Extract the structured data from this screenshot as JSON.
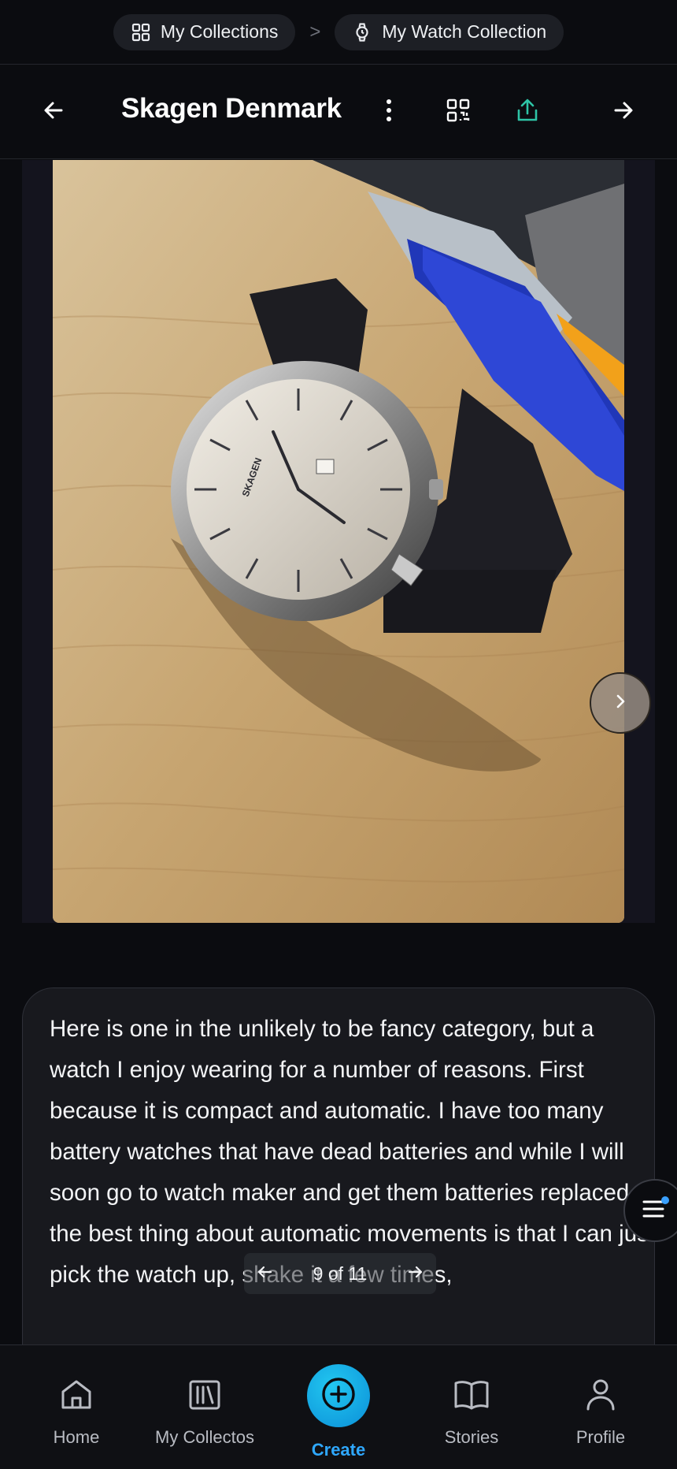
{
  "breadcrumb": {
    "collections_label": "My Collections",
    "separator": ">",
    "collection_label": "My Watch Collection"
  },
  "header": {
    "title": "Skagen Denmark"
  },
  "gallery": {
    "current": 9,
    "total": 11,
    "pager_label": "9 of 11"
  },
  "description": {
    "text": "Here is one in the unlikely to be fancy category, but a watch I enjoy wearing for a number of reasons. First because it is compact and automatic. I have too many battery watches that have dead batteries and while I will soon go to watch maker and get them batteries replaced- the best thing about automatic movements is that I can just pick the watch up, shake it a few times,"
  },
  "nav": {
    "home": "Home",
    "collections": "My Collectos",
    "create": "Create",
    "stories": "Stories",
    "profile": "Profile"
  },
  "colors": {
    "background": "#0b0c10",
    "accent": "#2fa8ff",
    "share_icon": "#2ec4a6"
  },
  "icons": {
    "collections": "grid-icon",
    "watch": "watch-icon",
    "back": "arrow-left-icon",
    "more": "kebab-icon",
    "qr": "qr-code-icon",
    "share": "share-icon",
    "forward": "arrow-right-icon",
    "menu": "menu-icon"
  }
}
